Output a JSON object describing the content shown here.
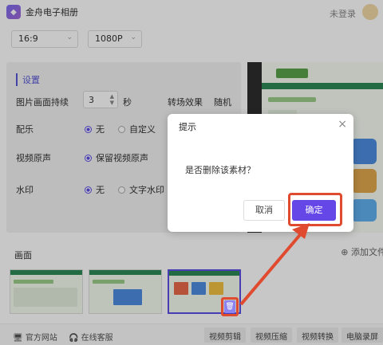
{
  "app": {
    "title": "金舟电子相册",
    "login": "未登录"
  },
  "selects": {
    "ratio": "16:9",
    "resolution": "1080P"
  },
  "settings": {
    "title": "设置",
    "duration_label": "图片画面持续",
    "duration_value": "3",
    "duration_unit": "秒",
    "transition_label": "转场效果",
    "transition_value": "随机",
    "music_label": "配乐",
    "music_opt1": "无",
    "music_opt2": "自定义",
    "voice_label": "视频原声",
    "voice_opt1": "保留视频原声",
    "watermark_label": "水印",
    "watermark_opt1": "无",
    "watermark_opt2": "文字水印"
  },
  "pictures": {
    "label": "画面",
    "add_file": "添加文件"
  },
  "footer": {
    "website": "官方网站",
    "service": "在线客服",
    "tabs": [
      "视频剪辑",
      "视频压缩",
      "视频转换",
      "电脑录屏"
    ]
  },
  "dialog": {
    "title": "提示",
    "message": "是否删除该素材？",
    "cancel": "取消",
    "confirm": "确定"
  },
  "colors": {
    "accent": "#6547e8",
    "annotation": "#e04a2e"
  }
}
